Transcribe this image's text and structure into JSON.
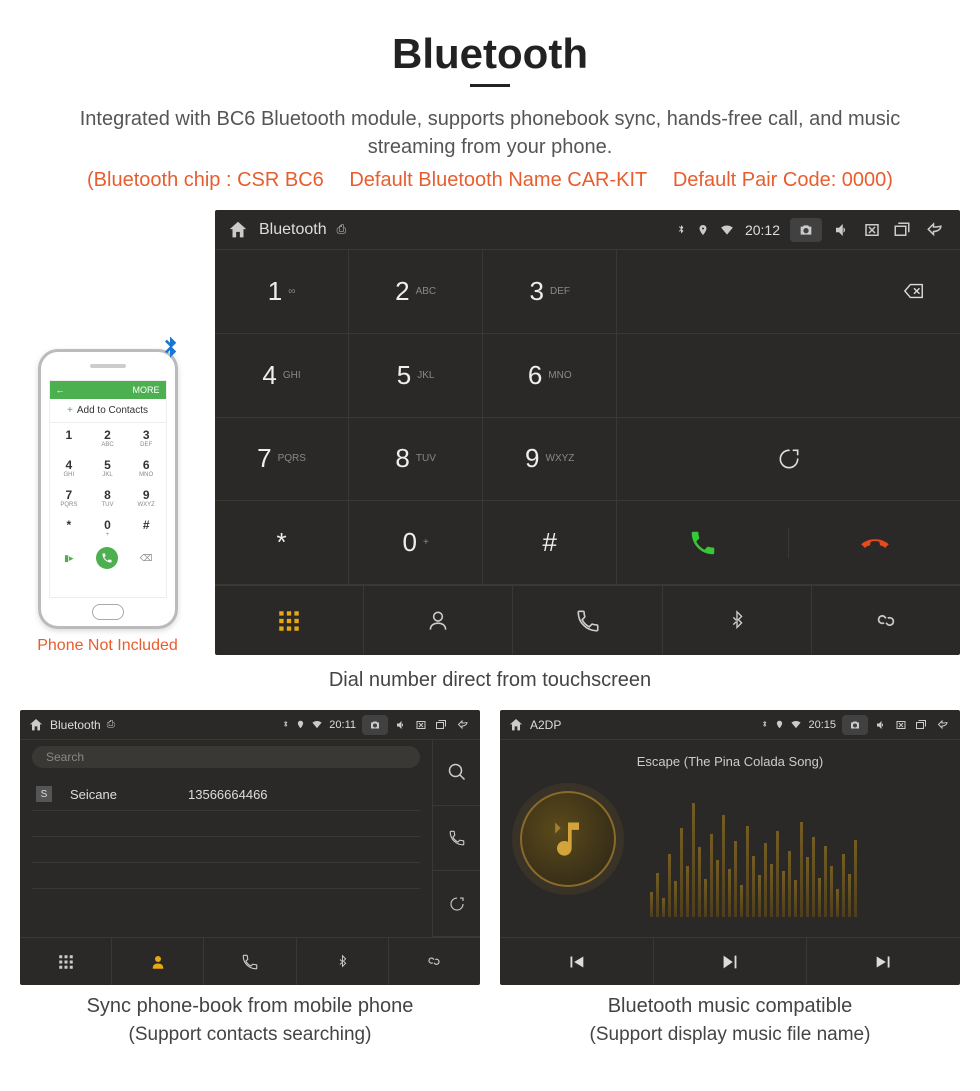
{
  "header": {
    "title": "Bluetooth",
    "subtitle": "Integrated with BC6 Bluetooth module, supports phonebook sync, hands-free call, and music streaming from your phone.",
    "spec_chip": "(Bluetooth chip : CSR BC6",
    "spec_name": "Default Bluetooth Name CAR-KIT",
    "spec_code": "Default Pair Code: 0000)"
  },
  "phone": {
    "status_left": "←",
    "status_right": "MORE",
    "add_contacts": "Add to Contacts",
    "note": "Phone Not Included"
  },
  "dialer": {
    "bar_title": "Bluetooth",
    "time": "20:12",
    "keys": [
      {
        "n": "1",
        "l": "∞"
      },
      {
        "n": "2",
        "l": "ABC"
      },
      {
        "n": "3",
        "l": "DEF"
      },
      {
        "n": "4",
        "l": "GHI"
      },
      {
        "n": "5",
        "l": "JKL"
      },
      {
        "n": "6",
        "l": "MNO"
      },
      {
        "n": "7",
        "l": "PQRS"
      },
      {
        "n": "8",
        "l": "TUV"
      },
      {
        "n": "9",
        "l": "WXYZ"
      },
      {
        "n": "*",
        "l": ""
      },
      {
        "n": "0",
        "l": "+"
      },
      {
        "n": "#",
        "l": ""
      }
    ],
    "caption": "Dial number direct from touchscreen"
  },
  "phonebook": {
    "bar_title": "Bluetooth",
    "time": "20:11",
    "search_placeholder": "Search",
    "contact_tag": "S",
    "contact_name": "Seicane",
    "contact_number": "13566664466",
    "caption1": "Sync phone-book from mobile phone",
    "caption2": "(Support contacts searching)"
  },
  "music": {
    "bar_title": "A2DP",
    "time": "20:15",
    "track": "Escape (The Pina Colada Song)",
    "caption1": "Bluetooth music compatible",
    "caption2": "(Support display music file name)"
  },
  "phonepad": {
    "keys": [
      {
        "n": "1",
        "l": ""
      },
      {
        "n": "2",
        "l": "ABC"
      },
      {
        "n": "3",
        "l": "DEF"
      },
      {
        "n": "4",
        "l": "GHI"
      },
      {
        "n": "5",
        "l": "JKL"
      },
      {
        "n": "6",
        "l": "MNO"
      },
      {
        "n": "7",
        "l": "PQRS"
      },
      {
        "n": "8",
        "l": "TUV"
      },
      {
        "n": "9",
        "l": "WXYZ"
      },
      {
        "n": "*",
        "l": ""
      },
      {
        "n": "0",
        "l": "+"
      },
      {
        "n": "#",
        "l": ""
      }
    ]
  }
}
